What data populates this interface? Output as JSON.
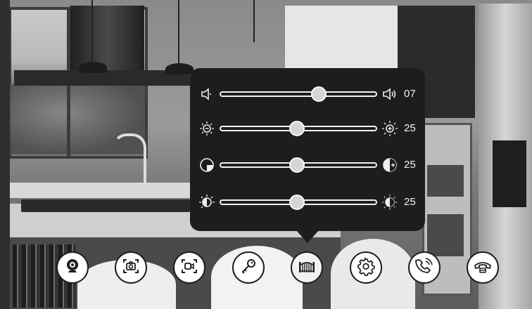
{
  "settings_panel": {
    "sliders": [
      {
        "id": "volume",
        "value": "07",
        "level": 0.63,
        "left_icon": "speaker-low-icon",
        "right_icon": "speaker-high-icon"
      },
      {
        "id": "brightness",
        "value": "25",
        "level": 0.49,
        "left_icon": "brightness-down-icon",
        "right_icon": "brightness-up-icon"
      },
      {
        "id": "contrast",
        "value": "25",
        "level": 0.49,
        "left_icon": "contrast-down-icon",
        "right_icon": "contrast-up-icon"
      },
      {
        "id": "color",
        "value": "25",
        "level": 0.49,
        "left_icon": "color-down-icon",
        "right_icon": "color-up-icon"
      }
    ]
  },
  "toolbar": {
    "buttons": [
      {
        "id": "monitor",
        "icon": "camera-monitor-icon"
      },
      {
        "id": "snapshot",
        "icon": "snapshot-icon"
      },
      {
        "id": "record",
        "icon": "video-record-icon"
      },
      {
        "id": "unlock",
        "icon": "key-icon"
      },
      {
        "id": "gate",
        "icon": "gate-icon",
        "active": true
      },
      {
        "id": "settings",
        "icon": "gear-icon"
      },
      {
        "id": "call",
        "icon": "phone-call-icon"
      },
      {
        "id": "hangup",
        "icon": "hang-up-icon"
      }
    ]
  },
  "colors": {
    "panel_bg": "#1d1d1d",
    "slider_track": "#f2f2f2",
    "slider_thumb": "#d5d5d5",
    "button_bg": "#ffffff"
  }
}
